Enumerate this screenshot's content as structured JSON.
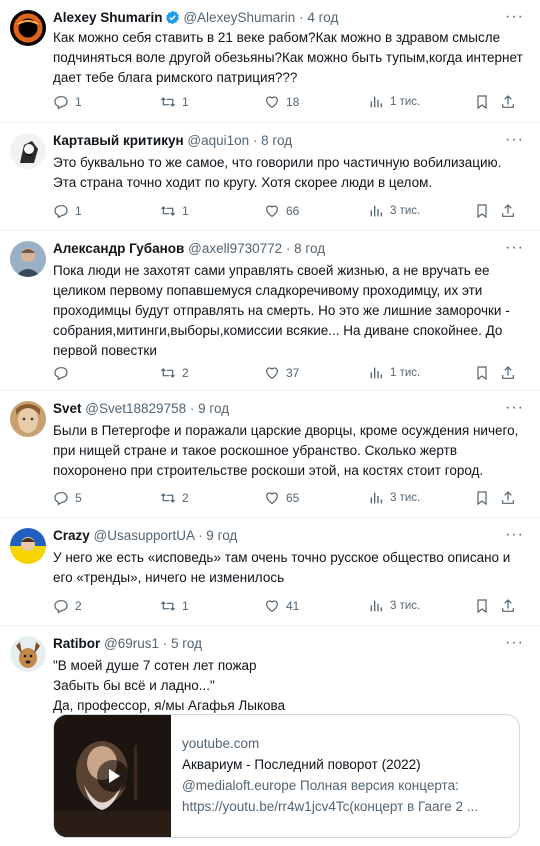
{
  "colors": {
    "text": "#0f1419",
    "secondary": "#536471",
    "verified": "#1d9bf0",
    "border": "#eff3f4"
  },
  "tweets": [
    {
      "name": "Alexey Shumarin",
      "handle": "@AlexeyShumarin",
      "time": "· 4 год",
      "verified": true,
      "avatar": "avatar-black-hole",
      "text": "Как можно себя ставить в 21 веке рабом?Как можно в здравом смысле подчиняться воле другой обезьяны?Как можно быть тупым,когда интернет дает тебе блага римского патриция???",
      "replies": "1",
      "retweets": "1",
      "likes": "18",
      "views": "1 тис."
    },
    {
      "name": "Картавый критикун",
      "handle": "@aqui1on",
      "time": "· 8 год",
      "avatar": "avatar-sketch",
      "text": "Это буквально то же самое, что говорили про частичную вобилизацию. Эта страна точно ходит по кругу. Хотя скорее люди в целом.",
      "replies": "1",
      "retweets": "1",
      "likes": "66",
      "views": "3 тис."
    },
    {
      "name": "Александр Губанов",
      "handle": "@axell9730772",
      "time": "· 8 год",
      "avatar": "avatar-photo-man",
      "text": "Пока люди не захотят сами управлять своей  жизнью, а не вручать ее целиком первому попавшемуся сладкоречивому проходимцу, их эти проходимцы будут отправлять на смерть. Но это же лишние заморочки - собрания,митинги,выборы,комиссии всякие... На диване спокойнее. До первой повестки",
      "replies": "",
      "retweets": "2",
      "likes": "37",
      "views": "1 тис."
    },
    {
      "name": "Svet",
      "handle": "@Svet18829758",
      "time": "· 9 год",
      "avatar": "avatar-painting-face",
      "text": "Были в Петергофе и поражали царские дворцы, кроме осуждения ничего, при нищей стране и такое роскошное убранство. Сколько жертв похоронено при строительстве роскоши этой, на костях стоит город.",
      "replies": "5",
      "retweets": "2",
      "likes": "65",
      "views": "3 тис."
    },
    {
      "name": "Crazy",
      "handle": "@UsasupportUA",
      "time": "· 9 год",
      "avatar": "avatar-flag-ukraine",
      "text": "У него же есть «исповедь» там очень точно русское общество описано и его «тренды», ничего не изменилось",
      "replies": "2",
      "retweets": "1",
      "likes": "41",
      "views": "3 тис."
    },
    {
      "name": "Ratibor",
      "handle": "@69rus1",
      "time": "· 5 год",
      "avatar": "avatar-dog",
      "text": "\"В моей душе 7 сотен лет пожар\nЗабыть бы всё и ладно...\"\nДа, профессор, я/мы Агафья Лыкова",
      "card": {
        "domain": "youtube.com",
        "title": "Аквариум - Последний поворот (2022)",
        "desc1": "@medialoft.europe Полная версия концерта:",
        "desc2": "https://youtu.be/rr4w1jcv4Tc(концерт в Гааге 2 ..."
      }
    }
  ]
}
